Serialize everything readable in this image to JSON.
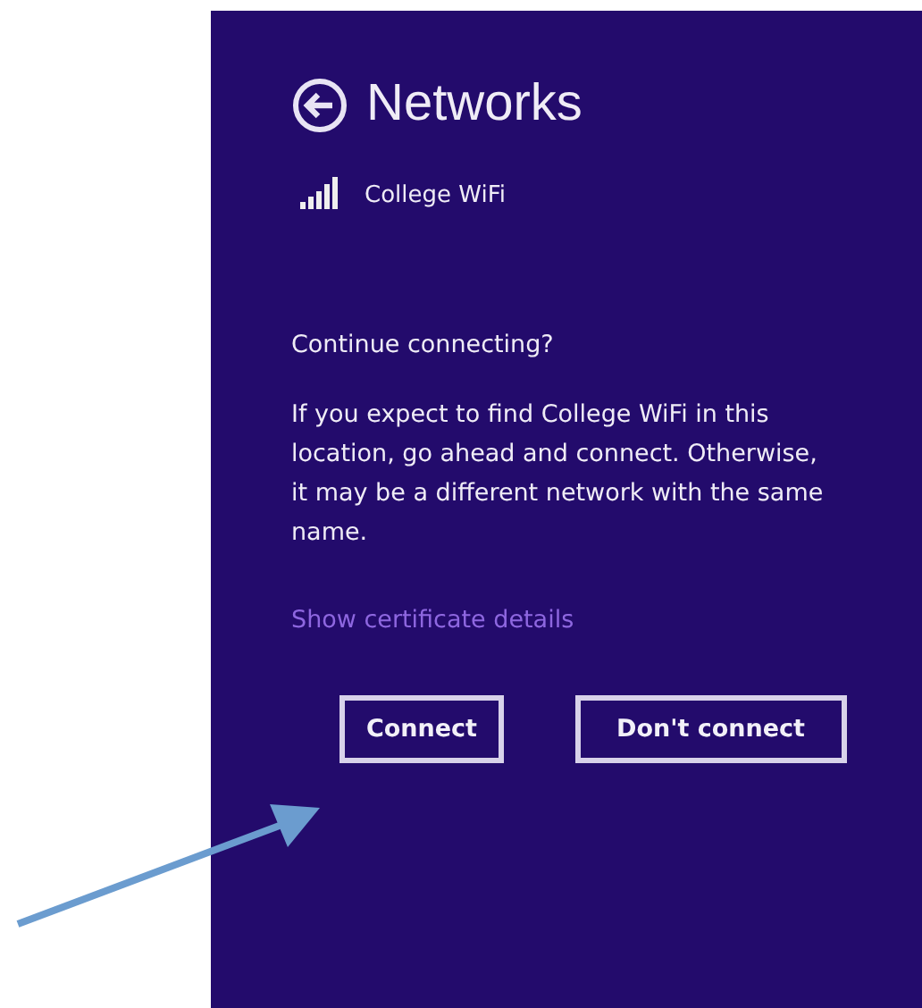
{
  "panel": {
    "title": "Networks",
    "network": {
      "name": "College WiFi"
    },
    "heading": "Continue connecting?",
    "message": "If you expect to find College WiFi in this location, go ahead and connect. Otherwise, it may be a different network with the same name.",
    "link": "Show certificate details",
    "buttons": [
      {
        "label": "Connect"
      },
      {
        "label": "Don't connect"
      }
    ]
  }
}
